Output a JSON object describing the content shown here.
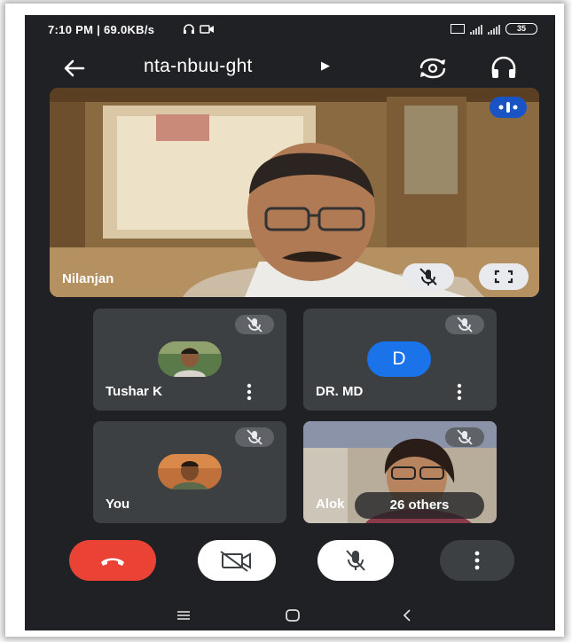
{
  "status_bar": {
    "time_speed": "7:10 PM | 69.0KB/s",
    "battery": "35"
  },
  "header": {
    "meeting_code": "nta-nbuu-ght"
  },
  "main_speaker": {
    "name": "Nilanjan"
  },
  "tiles": [
    {
      "name": "Tushar K"
    },
    {
      "name": "DR. MD",
      "avatar_letter": "D"
    },
    {
      "name": "You"
    },
    {
      "name": "Alok",
      "others_label": "26 others"
    }
  ],
  "colors": {
    "background": "#202124",
    "tile": "#3c4043",
    "end_call": "#ea4335",
    "accent_blue": "#1a73e8"
  },
  "icons": [
    "back-arrow-icon",
    "switch-camera-icon",
    "headphones-icon",
    "speaking-indicator-icon",
    "mute-icon",
    "fullscreen-icon",
    "mic-off-icon",
    "more-vert-icon",
    "call-end-icon",
    "camera-off-icon"
  ]
}
